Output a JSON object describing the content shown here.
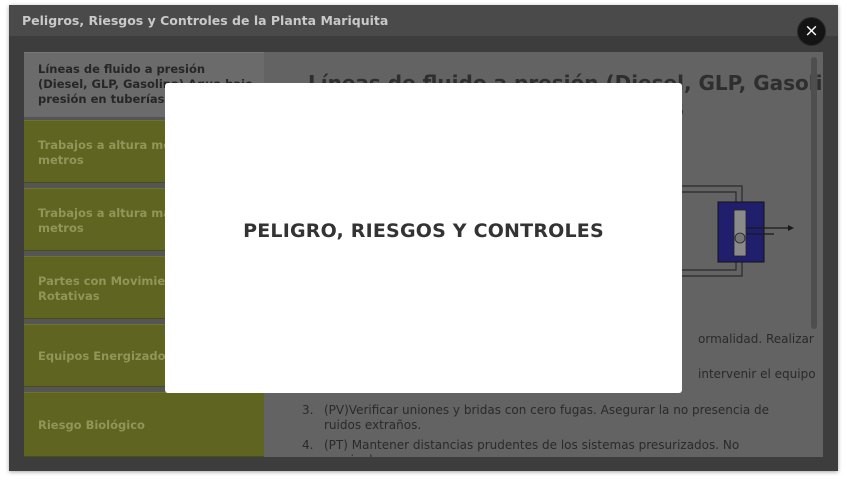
{
  "window": {
    "title": "Peligros, Riesgos y Controles de la Planta Mariquita",
    "close_label": "×"
  },
  "sidebar": {
    "items": [
      {
        "label": "Líneas de fluido a presión (Diesel, GLP, Gasolina) Agua bajo presión en tuberías",
        "active": true
      },
      {
        "label": "Trabajos a altura menor de 1,5 metros",
        "active": false
      },
      {
        "label": "Trabajos a altura mayor de 1,5 metros",
        "active": false
      },
      {
        "label": "Partes con Movimientos Rotativas",
        "active": false
      },
      {
        "label": "Equipos Energizados",
        "active": false
      },
      {
        "label": "Riesgo Biológico",
        "active": false
      }
    ]
  },
  "panel": {
    "title": "Líneas de fluido a presión (Diesel, GLP, Gasolina)",
    "title_tail": "s",
    "fragment_1": "ormalidad.  Realizar",
    "fragment_2": "intervenir el equipo",
    "steps": [
      {
        "num": "3.",
        "text": "(PV)Verificar uniones y bridas    con cero fugas. Asegurar la no presencia de ruidos extraños."
      },
      {
        "num": "4.",
        "text": "(PT)  Mantener distancias prudentes de los  sistemas presurizados. No manipular"
      }
    ]
  },
  "modal": {
    "title": "PELIGRO, RIESGOS Y CONTROLES"
  },
  "colors": {
    "sidebar_item": "#5f6420",
    "sidebar_active": "#6b6b6b",
    "overlay": "#3d3d3d",
    "modal_bg": "#ffffff",
    "diagram_blue": "#1f1f6e"
  }
}
